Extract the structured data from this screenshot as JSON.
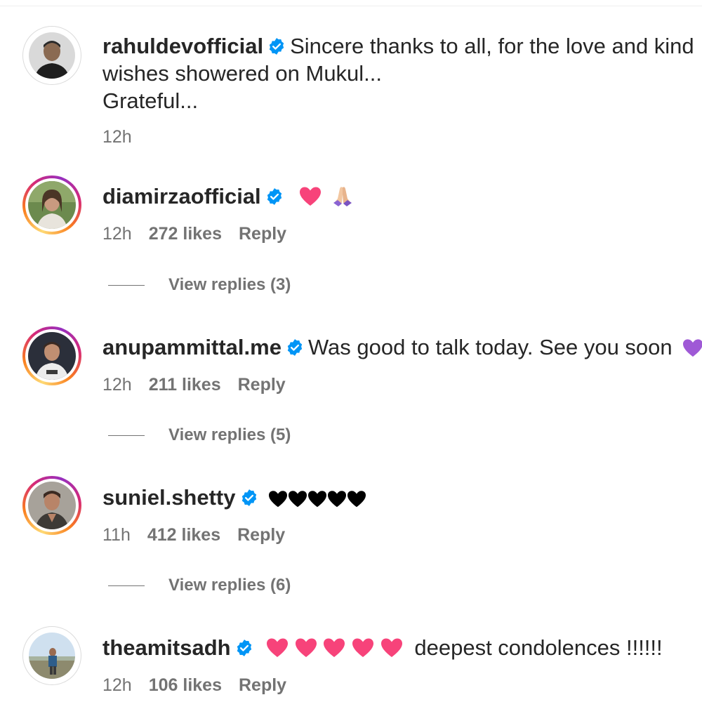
{
  "comments": [
    {
      "username": "rahuldevofficial",
      "text_lines": [
        "Sincere thanks to all, for the love and kind",
        "wishes showered on Mukul...",
        "Grateful..."
      ],
      "time": "12h",
      "likes": "",
      "reply": "",
      "avatar_icon": "man-portrait-avatar"
    },
    {
      "username": "diamirzaofficial",
      "text": "",
      "emoji": [
        "pink-heart",
        "folded-hands"
      ],
      "time": "12h",
      "likes": "272 likes",
      "reply": "Reply",
      "view_replies": "View replies (3)",
      "avatar_icon": "woman-portrait-avatar"
    },
    {
      "username": "anupammittal.me",
      "text": "Was good to talk today. See you soon",
      "emoji": [
        "purple-heart"
      ],
      "time": "12h",
      "likes": "211 likes",
      "reply": "Reply",
      "view_replies": "View replies (5)",
      "avatar_icon": "man-portrait-avatar"
    },
    {
      "username": "suniel.shetty",
      "text": "",
      "emoji": [
        "black-heart",
        "black-heart",
        "black-heart",
        "black-heart",
        "black-heart"
      ],
      "time": "11h",
      "likes": "412 likes",
      "reply": "Reply",
      "view_replies": "View replies (6)",
      "avatar_icon": "man-portrait-avatar"
    },
    {
      "username": "theamitsadh",
      "text": "deepest condolences !!!!!!",
      "emoji": [
        "pink-heart",
        "pink-heart",
        "pink-heart",
        "pink-heart",
        "pink-heart"
      ],
      "time": "12h",
      "likes": "106 likes",
      "reply": "Reply",
      "avatar_icon": "landscape-photo-avatar"
    }
  ],
  "colors": {
    "verified_blue": "#0095f6",
    "meta_gray": "#737373",
    "text": "#262626",
    "pink_heart": "#f7437a",
    "purple_heart": "#9f59d6"
  }
}
